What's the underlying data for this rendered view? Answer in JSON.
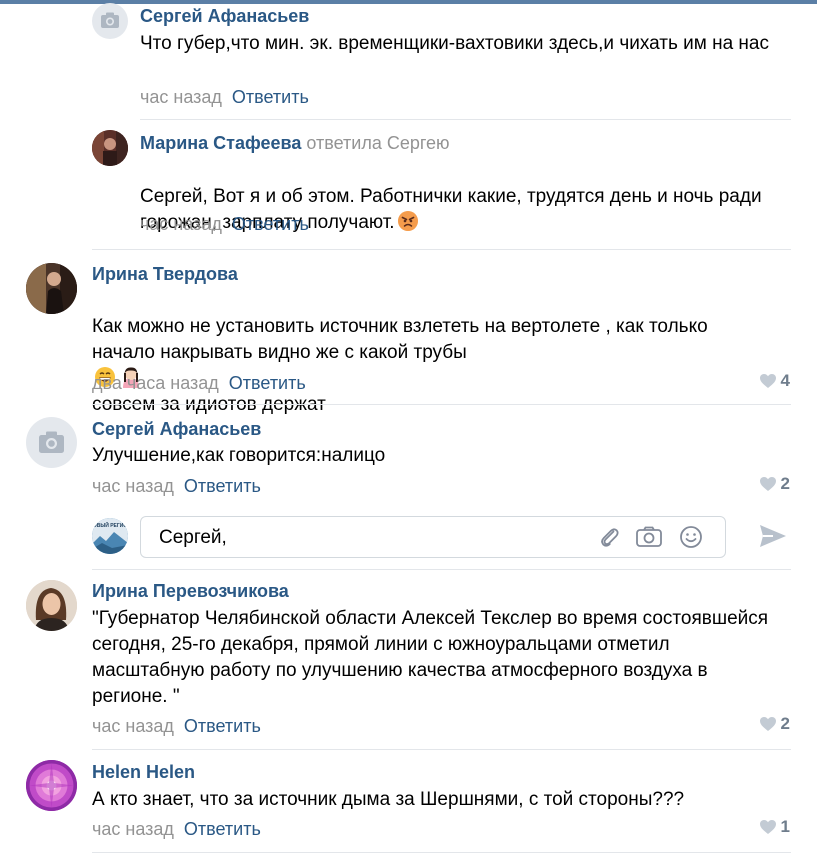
{
  "comments": [
    {
      "author": "Сергей Афанасьев",
      "reply_to": "",
      "text": "Что губер,что мин. эк. временщики-вахтовики здесь,и чихать им на нас",
      "time": "час назад",
      "reply": "Ответить",
      "likes": ""
    },
    {
      "author": "Марина Стафеева",
      "reply_to": "ответила Сергею",
      "text": "Сергей, Вот я и об этом. Работнички какие, трудятся день и ночь ради горожан, зарплату получают.",
      "time": "час назад",
      "reply": "Ответить",
      "likes": ""
    },
    {
      "author": "Ирина Твердова",
      "reply_to": "",
      "text_a": "Как можно не установить источник взлететь на вертолете , как только начало накрывать видно же с какой трубы",
      "text_b": "совсем за идиотов держат",
      "time": "два часа назад",
      "reply": "Ответить",
      "likes": "4"
    },
    {
      "author": "Сергей Афанасьев",
      "reply_to": "",
      "text": "Улучшение,как говорится:налицо",
      "time": "час назад",
      "reply": "Ответить",
      "likes": "2"
    },
    {
      "author": "Ирина Перевозчикова",
      "reply_to": "",
      "text": "\"Губернатор Челябинской области Алексей Текслер во время состоявшейся сегодня, 25-го декабря, прямой линии с южноуральцами отметил масштабную работу по улучшению качества атмосферного воздуха в регионе. \"",
      "time": "час назад",
      "reply": "Ответить",
      "likes": "2"
    },
    {
      "author": "Helen Helen",
      "reply_to": "",
      "text": "А кто знает, что за источник дыма за Шершнями, с той стороны???",
      "time": "час назад",
      "reply": "Ответить",
      "likes": "1"
    }
  ],
  "reply_box": {
    "value": "Сергей,",
    "avatar_text": "НОВЫЙ РЕГИОН"
  },
  "icons": {
    "camera": "camera-icon",
    "heart": "heart-icon",
    "attach": "paperclip-icon",
    "photo": "camera-icon",
    "smile": "smile-icon",
    "send": "send-icon"
  },
  "colors": {
    "author": "#2a5885",
    "meta": "#939393",
    "topbar": "#5b7fa6",
    "divider": "#e3e6ea"
  }
}
